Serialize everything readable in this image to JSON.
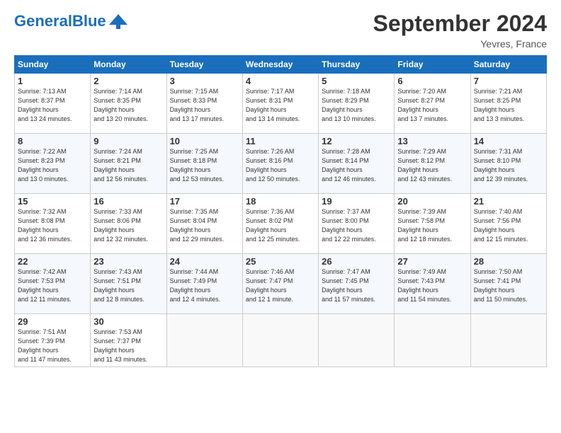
{
  "header": {
    "logo_general": "General",
    "logo_blue": "Blue",
    "month_title": "September 2024",
    "location": "Yevres, France"
  },
  "weekdays": [
    "Sunday",
    "Monday",
    "Tuesday",
    "Wednesday",
    "Thursday",
    "Friday",
    "Saturday"
  ],
  "weeks": [
    [
      {
        "day": 1,
        "sunrise": "7:13 AM",
        "sunset": "8:37 PM",
        "daylight": "13 hours and 24 minutes."
      },
      {
        "day": 2,
        "sunrise": "7:14 AM",
        "sunset": "8:35 PM",
        "daylight": "13 hours and 20 minutes."
      },
      {
        "day": 3,
        "sunrise": "7:15 AM",
        "sunset": "8:33 PM",
        "daylight": "13 hours and 17 minutes."
      },
      {
        "day": 4,
        "sunrise": "7:17 AM",
        "sunset": "8:31 PM",
        "daylight": "13 hours and 14 minutes."
      },
      {
        "day": 5,
        "sunrise": "7:18 AM",
        "sunset": "8:29 PM",
        "daylight": "13 hours and 10 minutes."
      },
      {
        "day": 6,
        "sunrise": "7:20 AM",
        "sunset": "8:27 PM",
        "daylight": "13 hours and 7 minutes."
      },
      {
        "day": 7,
        "sunrise": "7:21 AM",
        "sunset": "8:25 PM",
        "daylight": "13 hours and 3 minutes."
      }
    ],
    [
      {
        "day": 8,
        "sunrise": "7:22 AM",
        "sunset": "8:23 PM",
        "daylight": "13 hours and 0 minutes."
      },
      {
        "day": 9,
        "sunrise": "7:24 AM",
        "sunset": "8:21 PM",
        "daylight": "12 hours and 56 minutes."
      },
      {
        "day": 10,
        "sunrise": "7:25 AM",
        "sunset": "8:18 PM",
        "daylight": "12 hours and 53 minutes."
      },
      {
        "day": 11,
        "sunrise": "7:26 AM",
        "sunset": "8:16 PM",
        "daylight": "12 hours and 50 minutes."
      },
      {
        "day": 12,
        "sunrise": "7:28 AM",
        "sunset": "8:14 PM",
        "daylight": "12 hours and 46 minutes."
      },
      {
        "day": 13,
        "sunrise": "7:29 AM",
        "sunset": "8:12 PM",
        "daylight": "12 hours and 43 minutes."
      },
      {
        "day": 14,
        "sunrise": "7:31 AM",
        "sunset": "8:10 PM",
        "daylight": "12 hours and 39 minutes."
      }
    ],
    [
      {
        "day": 15,
        "sunrise": "7:32 AM",
        "sunset": "8:08 PM",
        "daylight": "12 hours and 36 minutes."
      },
      {
        "day": 16,
        "sunrise": "7:33 AM",
        "sunset": "8:06 PM",
        "daylight": "12 hours and 32 minutes."
      },
      {
        "day": 17,
        "sunrise": "7:35 AM",
        "sunset": "8:04 PM",
        "daylight": "12 hours and 29 minutes."
      },
      {
        "day": 18,
        "sunrise": "7:36 AM",
        "sunset": "8:02 PM",
        "daylight": "12 hours and 25 minutes."
      },
      {
        "day": 19,
        "sunrise": "7:37 AM",
        "sunset": "8:00 PM",
        "daylight": "12 hours and 22 minutes."
      },
      {
        "day": 20,
        "sunrise": "7:39 AM",
        "sunset": "7:58 PM",
        "daylight": "12 hours and 18 minutes."
      },
      {
        "day": 21,
        "sunrise": "7:40 AM",
        "sunset": "7:56 PM",
        "daylight": "12 hours and 15 minutes."
      }
    ],
    [
      {
        "day": 22,
        "sunrise": "7:42 AM",
        "sunset": "7:53 PM",
        "daylight": "12 hours and 11 minutes."
      },
      {
        "day": 23,
        "sunrise": "7:43 AM",
        "sunset": "7:51 PM",
        "daylight": "12 hours and 8 minutes."
      },
      {
        "day": 24,
        "sunrise": "7:44 AM",
        "sunset": "7:49 PM",
        "daylight": "12 hours and 4 minutes."
      },
      {
        "day": 25,
        "sunrise": "7:46 AM",
        "sunset": "7:47 PM",
        "daylight": "12 hours and 1 minute."
      },
      {
        "day": 26,
        "sunrise": "7:47 AM",
        "sunset": "7:45 PM",
        "daylight": "11 hours and 57 minutes."
      },
      {
        "day": 27,
        "sunrise": "7:49 AM",
        "sunset": "7:43 PM",
        "daylight": "11 hours and 54 minutes."
      },
      {
        "day": 28,
        "sunrise": "7:50 AM",
        "sunset": "7:41 PM",
        "daylight": "11 hours and 50 minutes."
      }
    ],
    [
      {
        "day": 29,
        "sunrise": "7:51 AM",
        "sunset": "7:39 PM",
        "daylight": "11 hours and 47 minutes."
      },
      {
        "day": 30,
        "sunrise": "7:53 AM",
        "sunset": "7:37 PM",
        "daylight": "11 hours and 43 minutes."
      },
      null,
      null,
      null,
      null,
      null
    ]
  ]
}
